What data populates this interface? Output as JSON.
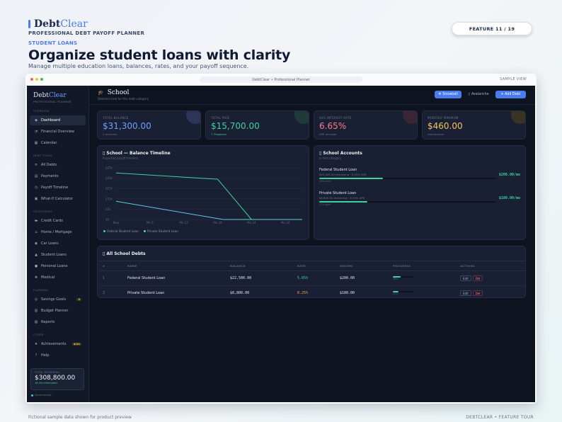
{
  "header": {
    "brand_main": "Debt",
    "brand_accent": "Clear",
    "tagline": "PROFESSIONAL DEBT PAYOFF PLANNER",
    "section": "STUDENT LOANS",
    "headline": "Organize student loans with clarity",
    "subline": "Manage multiple education loans, balances, rates, and your payoff sequence.",
    "feature": "FEATURE 11 / 19"
  },
  "window": {
    "url": "DebtClear  •  Professional Planner",
    "sample": "SAMPLE VIEW"
  },
  "footer": {
    "left": "Fictional sample data shown for product preview",
    "right": "DEBTCLEAR  •  FEATURE TOUR"
  },
  "sidebar": {
    "brand_main": "Debt",
    "brand_accent": "Clear",
    "brand_sub": "PROFESSIONAL PLANNER",
    "groups": [
      {
        "label": "OVERVIEW",
        "items": [
          {
            "label": "Dashboard",
            "icon": "◆",
            "active": true
          },
          {
            "label": "Financial Overview",
            "icon": "◔"
          },
          {
            "label": "Calendar",
            "icon": "▦"
          }
        ]
      },
      {
        "label": "DEBT TOOLS",
        "items": [
          {
            "label": "All Debts",
            "icon": "≡"
          },
          {
            "label": "Payments",
            "icon": "▤"
          },
          {
            "label": "Payoff Timeline",
            "icon": "◷"
          },
          {
            "label": "What-If Calculator",
            "icon": "▣"
          }
        ]
      },
      {
        "label": "CATEGORIES",
        "items": [
          {
            "label": "Credit Cards",
            "icon": "▬"
          },
          {
            "label": "Home / Mortgage",
            "icon": "⌂"
          },
          {
            "label": "Car Loans",
            "icon": "◉"
          },
          {
            "label": "Student Loans",
            "icon": "▲"
          },
          {
            "label": "Personal Loans",
            "icon": "●"
          },
          {
            "label": "Medical",
            "icon": "✚"
          }
        ]
      },
      {
        "label": "PLANNING",
        "items": [
          {
            "label": "Savings Goals",
            "icon": "◎",
            "badge": "3"
          },
          {
            "label": "Budget Planner",
            "icon": "▥"
          },
          {
            "label": "Reports",
            "icon": "▧"
          }
        ]
      },
      {
        "label": "OTHER",
        "items": [
          {
            "label": "Achievements",
            "icon": "★",
            "badge": "4/11"
          },
          {
            "label": "Help",
            "icon": "?"
          }
        ]
      }
    ],
    "remaining_label": "TOTAL REMAINING",
    "remaining_value": "$308,800.00",
    "remaining_sub": "18.4% eliminated",
    "saved": "Saved locally"
  },
  "topbar": {
    "icon": "🎓",
    "title": "School",
    "subtitle": "Detailed view for this debt category",
    "snowball": "Snowball",
    "avalanche": "Avalanche",
    "add": "+ Add Debt"
  },
  "stats": [
    {
      "label": "TOTAL BALANCE",
      "value": "$31,300.00",
      "sub": "2 accounts",
      "color": "#6ea0ff",
      "blob": "#2b3558"
    },
    {
      "label": "TOTAL PAID",
      "value": "$15,700.00",
      "sub": "↑ Progress!",
      "color": "#3fd1a0",
      "blob": "#1f3a3a",
      "sub_color": "#3fd1a0"
    },
    {
      "label": "AVG INTEREST RATE",
      "value": "6.65%",
      "sub": "APR average",
      "color": "#ff7a8a",
      "blob": "#3a2536"
    },
    {
      "label": "MONTHLY MINIMUM",
      "value": "$460.00",
      "sub": "required/mo",
      "color": "#f3c55a",
      "blob": "#3a3324"
    }
  ],
  "timeline": {
    "title": "▯ School — Balance Timeline",
    "subtitle": "Projected payoff timeline",
    "legend": [
      "Federal Student Loan",
      "Private Student Loan"
    ]
  },
  "accounts": {
    "title": "▯ School Accounts",
    "subtitle": "In this category",
    "items": [
      {
        "name": "Federal Student Loan",
        "meta": "$22,500.00 remaining · 5.05% APR",
        "payment": "$200.00/mo",
        "progress": 0.36,
        "pct": "36% paid"
      },
      {
        "name": "Private Student Loan",
        "meta": "$8,800.00 remaining · 8.25% APR",
        "payment": "$180.00/mo",
        "progress": 0.27,
        "pct": "27% paid"
      }
    ]
  },
  "table": {
    "title": "▯ All School Debts",
    "headers": [
      "#",
      "NAME",
      "BALANCE",
      "RATE",
      "MIN/MO",
      "PROGRESS",
      "ACTIONS"
    ],
    "rows": [
      {
        "num": "1",
        "name": "Federal Student Loan",
        "balance": "$22,500.00",
        "rate": "5.05%",
        "rate_color": "#3fd1a0",
        "min": "$200.00",
        "progress": 0.36,
        "pct": "36%",
        "edit": "Edit",
        "del": "Del"
      },
      {
        "num": "2",
        "name": "Private Student Loan",
        "balance": "$8,800.00",
        "rate": "8.25%",
        "rate_color": "#f3a05a",
        "min": "$180.00",
        "progress": 0.27,
        "pct": "27%",
        "edit": "Edit",
        "del": "Del"
      }
    ]
  },
  "chart_data": {
    "type": "line",
    "title": "School — Balance Timeline",
    "subtitle": "Projected payoff timeline",
    "x": [
      "Now",
      "Mo 6",
      "Mo 12",
      "Mo 18",
      "Mo 24",
      "Mo 30"
    ],
    "y_ticks": [
      "$0",
      "$5k",
      "$10k",
      "$15k",
      "$20k",
      "$25k"
    ],
    "ylim": [
      0,
      25000
    ],
    "series": [
      {
        "name": "Federal Student Loan",
        "color": "#3fd1a0",
        "x_months": [
          0,
          18,
          24,
          33
        ],
        "values": [
          22500,
          19500,
          0,
          0
        ]
      },
      {
        "name": "Private Student Loan",
        "color": "#5ec8e0",
        "x_months": [
          0,
          19,
          33
        ],
        "values": [
          8800,
          0,
          0
        ]
      }
    ],
    "legend": "bottom-left",
    "grid": true
  }
}
